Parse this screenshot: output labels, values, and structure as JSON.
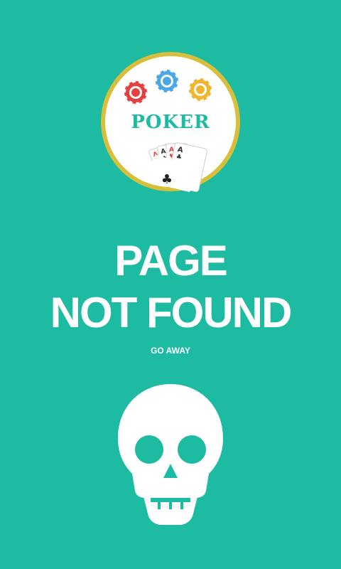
{
  "logo": {
    "text": "POKER",
    "ring_color": "#d8bf3b",
    "circle_color": "#ffffff",
    "chip_colors": [
      "#e53f3f",
      "#4aa8e6",
      "#f0b52d"
    ],
    "card_icon": "club-icon"
  },
  "headline": {
    "line1": "PAGE",
    "line2": "NOT FOUND"
  },
  "subtitle": "GO AWAY",
  "icon": "skull-icon",
  "colors": {
    "background": "#1dbba1",
    "text": "#ffffff",
    "poker_text": "#1dbba1"
  }
}
